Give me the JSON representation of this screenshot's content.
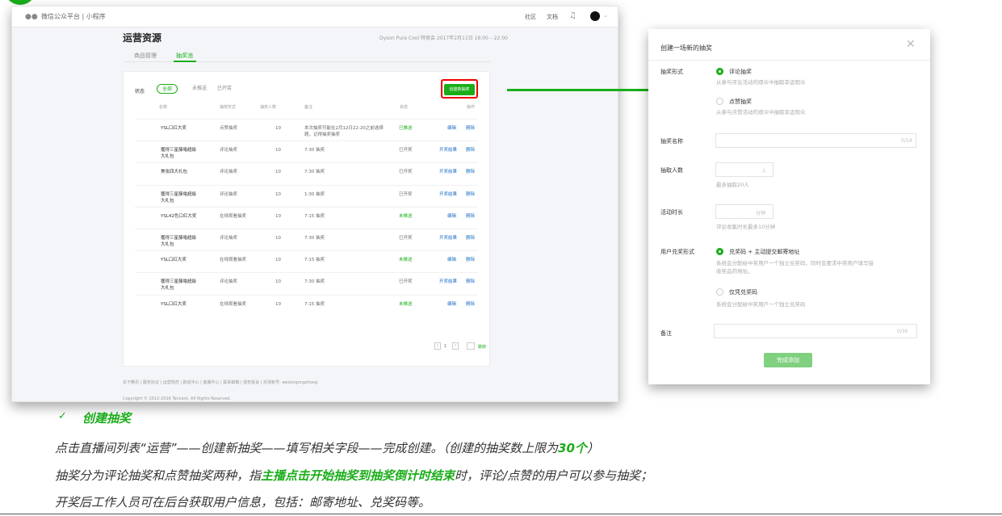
{
  "window": {
    "platform_title": "微信公众平台 | 小程序",
    "nav_right": [
      "社区",
      "文档"
    ],
    "page_title": "运营资源",
    "event_meta": "Dyson Pure Cool 特卖会   2017年2月11日 18:00 – 22:00",
    "tabs": [
      "商品管理",
      "抽奖池"
    ],
    "filter": {
      "label": "状态",
      "options": [
        "全部",
        "未推送",
        "已开奖"
      ]
    },
    "create_button": "创建新抽奖",
    "table": {
      "headers": [
        "名称",
        "抽奖形式",
        "抽奖人数",
        "备注",
        "状态",
        "操作"
      ],
      "rows": [
        {
          "name": "YSL口红大奖",
          "type": "点赞抽奖",
          "count": "10",
          "note": "本次抽奖可能在2月12日22:20之前选择\n题，记得抽奖抽奖",
          "status": "已推送",
          "ops": [
            "编辑",
            "删除"
          ]
        },
        {
          "name": "獲得三星靜電超級\n大礼包",
          "type": "评论抽奖",
          "count": "10",
          "note": "7:30 抽奖",
          "status": "已开奖",
          "ops": [
            "开奖结果",
            "删除"
          ]
        },
        {
          "name": "美妆四大礼包",
          "type": "评论抽奖",
          "count": "10",
          "note": "7:30 抽奖",
          "status": "已开奖",
          "ops": [
            "开奖结果",
            "删除"
          ]
        },
        {
          "name": "獲得三星靜電超級\n大礼包",
          "type": "评论抽奖",
          "count": "10",
          "note": "1:30 抽奖",
          "status": "已开奖",
          "ops": [
            "开奖结果",
            "删除"
          ]
        },
        {
          "name": "YSL42色口红大奖",
          "type": "在线观看抽奖",
          "count": "10",
          "note": "7:15 抽奖",
          "status": "未推送",
          "ops": [
            "编辑",
            "删除"
          ]
        },
        {
          "name": "獲得三星靜電超級\n大礼包",
          "type": "评论抽奖",
          "count": "10",
          "note": "7:30 抽奖",
          "status": "已开奖",
          "ops": [
            "开奖结果",
            "删除"
          ]
        },
        {
          "name": "YSL口红大奖",
          "type": "在线观看抽奖",
          "count": "10",
          "note": "7:15 抽奖",
          "status": "未推送",
          "ops": [
            "编辑",
            "删除"
          ]
        },
        {
          "name": "獲得三星靜電超級\n大礼包",
          "type": "评论抽奖",
          "count": "10",
          "note": "7:30 抽奖",
          "status": "已开奖",
          "ops": [
            "开奖结果",
            "删除"
          ]
        },
        {
          "name": "YSL口红大奖",
          "type": "在线观看抽奖",
          "count": "10",
          "note": "7:15 抽奖",
          "status": "未推送",
          "ops": [
            "编辑",
            "删除"
          ]
        }
      ]
    },
    "pagination": {
      "current": "1",
      "jump": "跳转"
    },
    "footer": "关于腾讯 | 服务协议 | 运营规范 | 辟谣中心 | 客服中心 | 联系邮箱 | 侵权投诉 | 反馈帐号: weixingongzhong",
    "copyright": "Copyright © 2012-2016 Tencent. All Rights Reserved."
  },
  "dialog": {
    "title": "创建一场新的抽奖",
    "form_label": "抽奖形式",
    "form_opt1": "评论抽奖",
    "form_opt1_hint": "从参与评论活动的观众中抽取幸运观众",
    "form_opt2": "点赞抽奖",
    "form_opt2_hint": "从参与点赞活动的观众中抽取幸运观众",
    "name_label": "抽奖名称",
    "name_counter": "0/14",
    "count_label": "抽取人数",
    "count_unit": "人",
    "count_hint": "最多抽取20人",
    "dur_label": "活动时长",
    "dur_unit": "分钟",
    "dur_hint": "评论收集时长最多10分钟",
    "redeem_label": "用户兑奖形式",
    "redeem_opt1": "兑奖码 + 主动提交邮寄地址",
    "redeem_opt1_hint": "系统会分配给中奖用户一个独立兑奖码，同时会要求中奖用户填写接\n收奖品的地址。",
    "redeem_opt2": "仅凭兑奖码",
    "redeem_opt2_hint": "系统会分配给中奖用户一个独立兑奖码",
    "note_label": "备注",
    "note_counter": "0/30",
    "submit": "完成添加"
  },
  "caption": {
    "check_icon": "✓",
    "title": "创建抽奖",
    "line1_a": "点击直播间列表“运营”——创建新抽奖——填写相关字段——完成创建。（创建的抽奖数上限为",
    "line1_b": "30个",
    "line1_c": "）",
    "line2_a": "抽奖分为评论抽奖和点赞抽奖两种，指",
    "line2_b": "主播点击开始抽奖到抽奖倒计时结束",
    "line2_c": "时，评论/点赞的用户可以参与抽奖；",
    "line3": "开奖后工作人员可在后台获取用户信息，包括：邮寄地址、兑奖码等。"
  },
  "colors": {
    "accent": "#1aad19",
    "highlight": "#e00000"
  }
}
